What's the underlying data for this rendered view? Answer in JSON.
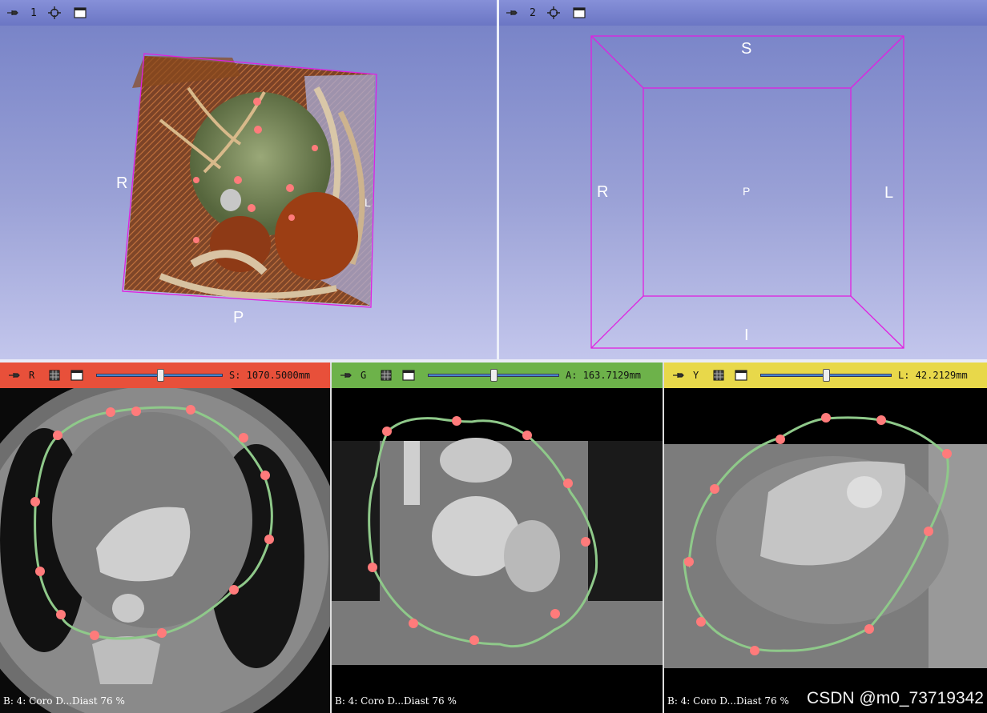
{
  "views3d": [
    {
      "number": "1",
      "orient": {
        "top": "",
        "left": "R",
        "right": "L",
        "bottom": "P"
      }
    },
    {
      "number": "2",
      "orient": {
        "top": "S",
        "left": "R",
        "center": "P",
        "right": "L",
        "bottom": "I"
      }
    }
  ],
  "slices": [
    {
      "letter": "R",
      "color": "#e8503a",
      "readout": "S: 1070.5000mm",
      "slider_fraction": 0.5,
      "info": "B: 4: Coro  D...Diast 76 %"
    },
    {
      "letter": "G",
      "color": "#6db24a",
      "readout": "A: 163.7129mm",
      "slider_fraction": 0.5,
      "info": "B: 4: Coro  D...Diast 76 %"
    },
    {
      "letter": "Y",
      "color": "#e8d84a",
      "readout": "L: 42.2129mm",
      "slider_fraction": 0.5,
      "info": "B: 4: Coro  D...Diast 76 %"
    }
  ],
  "watermark": "CSDN @m0_73719342",
  "icons": {
    "pin": "pin-icon",
    "crosshair": "crosshair-icon",
    "maximize": "maximize-view-icon"
  },
  "colors": {
    "contour": "#8fc98a",
    "control_point": "#ff7b7b",
    "roi_box": "#e020e0"
  }
}
